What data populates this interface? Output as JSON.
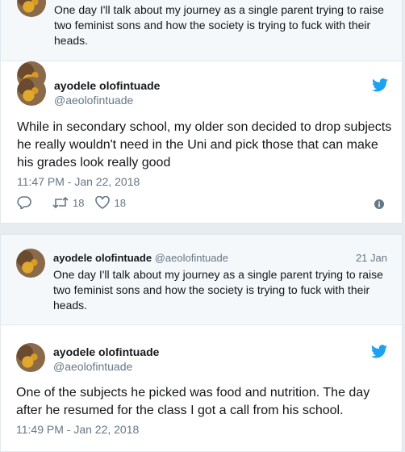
{
  "parent1": {
    "text": "One day I'll talk about my journey as a single parent trying to raise two feminist sons and how the society is trying to fuck with their heads."
  },
  "tweet1": {
    "name": "ayodele olofintuade",
    "handle": "@aeolofintuade",
    "text": "While in secondary school, my older son decided to drop subjects he really wouldn't need in the Uni and pick those that can make his grades look really good",
    "time": "11:47 PM - Jan 22, 2018",
    "retweets": "18",
    "likes": "18"
  },
  "parent2": {
    "name": "ayodele olofintuade",
    "handle": "@aeolofintuade",
    "date": "21 Jan",
    "text": "One day I'll talk about my journey as a single parent trying to raise two feminist sons and how the society is trying to fuck with their heads."
  },
  "tweet2": {
    "name": "ayodele olofintuade",
    "handle": "@aeolofintuade",
    "text": "One of the subjects he picked was food and nutrition. The day after he resumed for the class I got a call from his school.",
    "time": "11:49 PM - Jan 22, 2018"
  },
  "colors": {
    "twitter_blue": "#1da1f2",
    "secondary": "#657786",
    "parent_bg": "#f5f8fa"
  },
  "icons": [
    "twitter-bird-icon",
    "reply-icon",
    "retweet-icon",
    "like-icon",
    "info-icon"
  ]
}
